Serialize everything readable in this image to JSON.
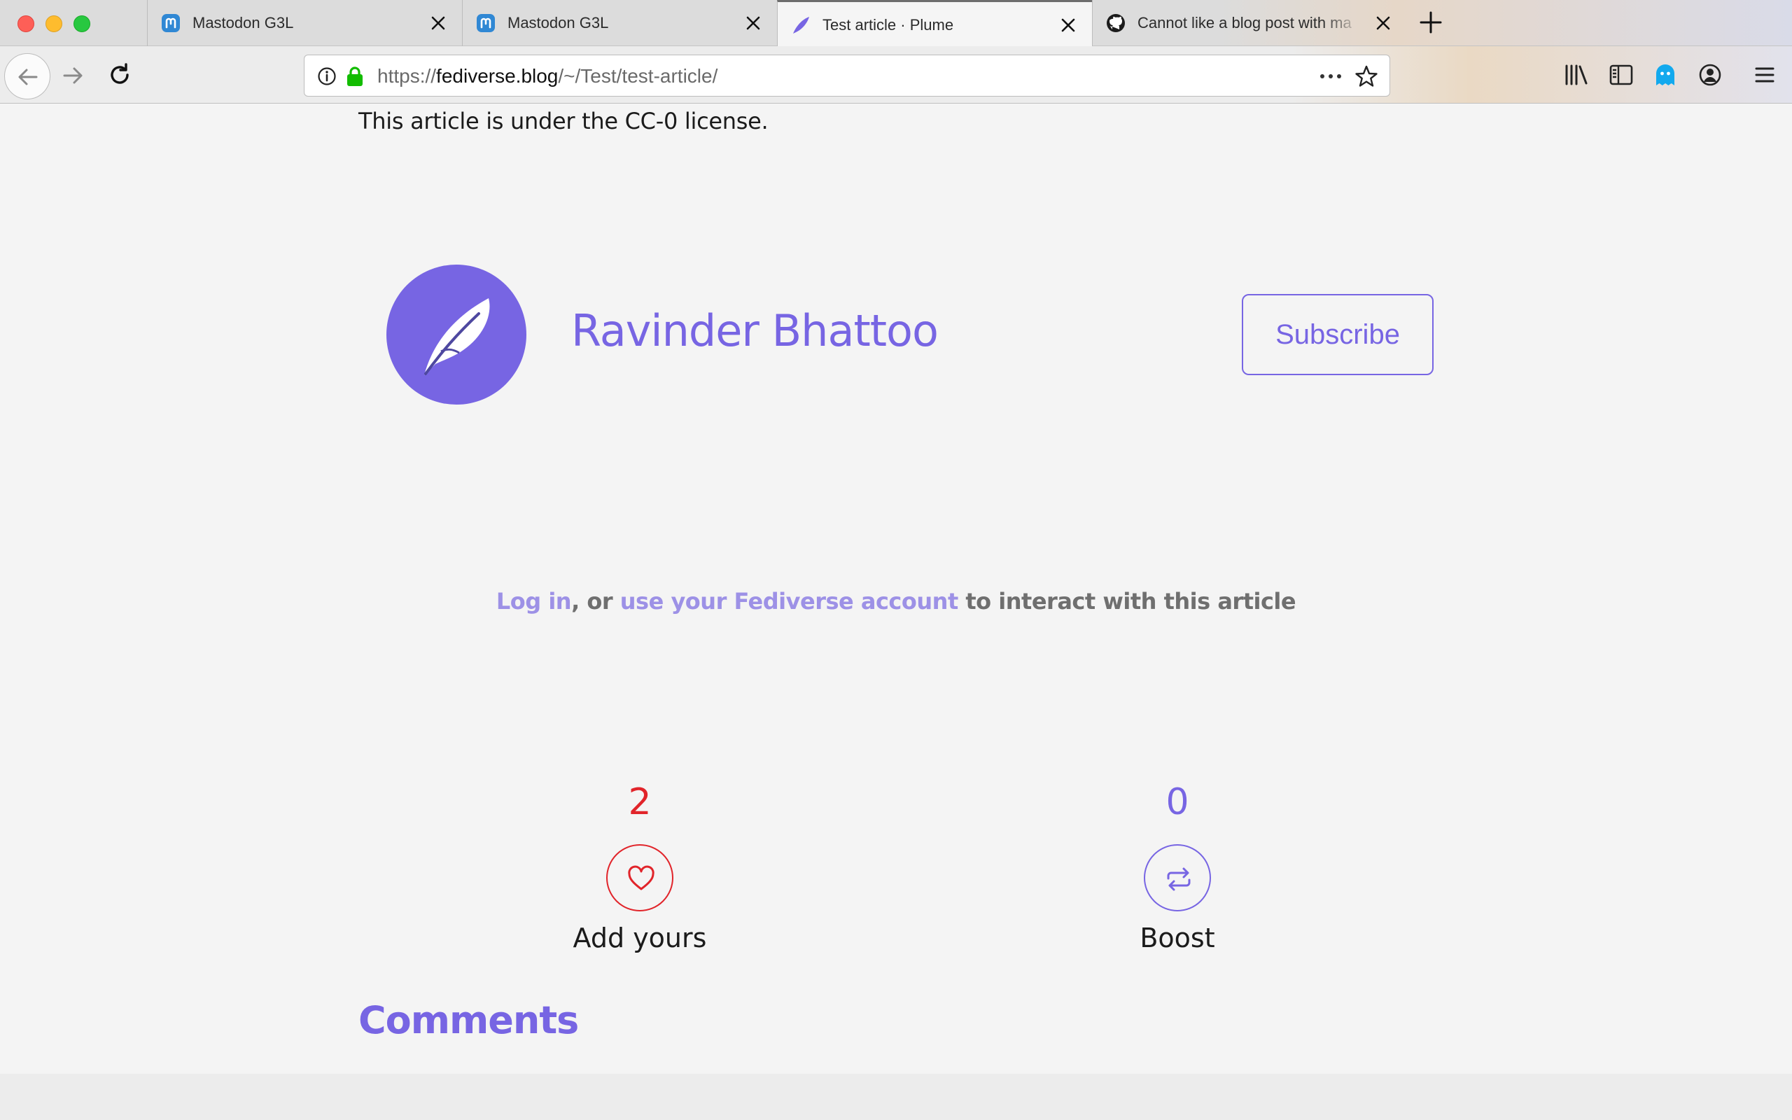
{
  "browser": {
    "tabs": [
      {
        "title": "Mastodon G3L",
        "icon": "mastodon-icon",
        "active": false
      },
      {
        "title": "Mastodon G3L",
        "icon": "mastodon-icon",
        "active": false
      },
      {
        "title": "Test article · Plume",
        "icon": "plume-feather-icon",
        "active": true
      },
      {
        "title": "Cannot like a blog post with ma",
        "icon": "github-icon",
        "active": false
      }
    ],
    "url": {
      "scheme": "https://",
      "host": "fediverse.blog",
      "path": "/~/Test/test-article/"
    }
  },
  "page": {
    "license_text": "This article is under the CC-0 license.",
    "author": {
      "name": "Ravinder Bhattoo",
      "subscribe_label": "Subscribe"
    },
    "interact": {
      "login_link": "Log in",
      "separator": ", or ",
      "fediverse_link": "use your Fediverse account",
      "suffix": " to interact with this article"
    },
    "likes": {
      "count": "2",
      "label": "Add yours"
    },
    "boosts": {
      "count": "0",
      "label": "Boost"
    },
    "comments_heading": "Comments"
  },
  "colors": {
    "accent": "#7765e3",
    "like_red": "#e1242a",
    "link_light": "#9d91e6"
  }
}
